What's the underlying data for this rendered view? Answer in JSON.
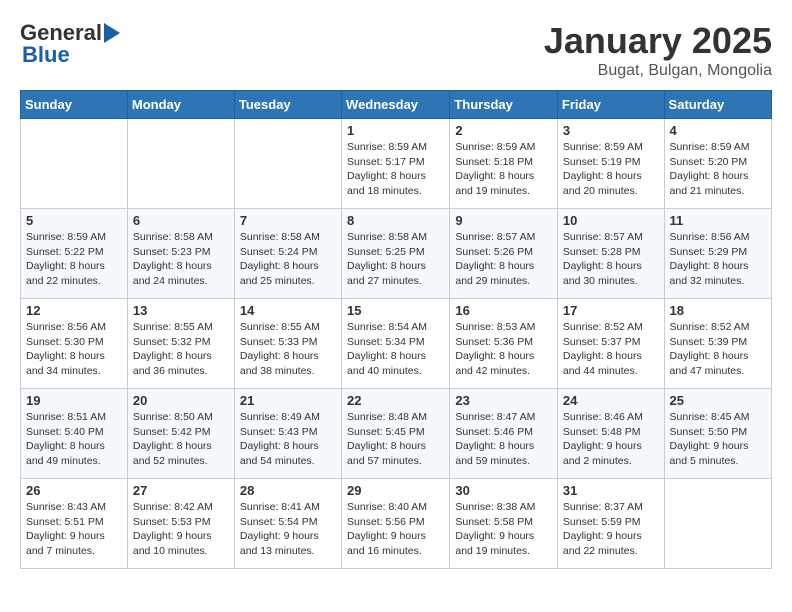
{
  "header": {
    "logo_general": "General",
    "logo_blue": "Blue",
    "month_title": "January 2025",
    "location": "Bugat, Bulgan, Mongolia"
  },
  "weekdays": [
    "Sunday",
    "Monday",
    "Tuesday",
    "Wednesday",
    "Thursday",
    "Friday",
    "Saturday"
  ],
  "weeks": [
    [
      {
        "day": "",
        "sunrise": "",
        "sunset": "",
        "daylight": ""
      },
      {
        "day": "",
        "sunrise": "",
        "sunset": "",
        "daylight": ""
      },
      {
        "day": "",
        "sunrise": "",
        "sunset": "",
        "daylight": ""
      },
      {
        "day": "1",
        "sunrise": "Sunrise: 8:59 AM",
        "sunset": "Sunset: 5:17 PM",
        "daylight": "Daylight: 8 hours and 18 minutes."
      },
      {
        "day": "2",
        "sunrise": "Sunrise: 8:59 AM",
        "sunset": "Sunset: 5:18 PM",
        "daylight": "Daylight: 8 hours and 19 minutes."
      },
      {
        "day": "3",
        "sunrise": "Sunrise: 8:59 AM",
        "sunset": "Sunset: 5:19 PM",
        "daylight": "Daylight: 8 hours and 20 minutes."
      },
      {
        "day": "4",
        "sunrise": "Sunrise: 8:59 AM",
        "sunset": "Sunset: 5:20 PM",
        "daylight": "Daylight: 8 hours and 21 minutes."
      }
    ],
    [
      {
        "day": "5",
        "sunrise": "Sunrise: 8:59 AM",
        "sunset": "Sunset: 5:22 PM",
        "daylight": "Daylight: 8 hours and 22 minutes."
      },
      {
        "day": "6",
        "sunrise": "Sunrise: 8:58 AM",
        "sunset": "Sunset: 5:23 PM",
        "daylight": "Daylight: 8 hours and 24 minutes."
      },
      {
        "day": "7",
        "sunrise": "Sunrise: 8:58 AM",
        "sunset": "Sunset: 5:24 PM",
        "daylight": "Daylight: 8 hours and 25 minutes."
      },
      {
        "day": "8",
        "sunrise": "Sunrise: 8:58 AM",
        "sunset": "Sunset: 5:25 PM",
        "daylight": "Daylight: 8 hours and 27 minutes."
      },
      {
        "day": "9",
        "sunrise": "Sunrise: 8:57 AM",
        "sunset": "Sunset: 5:26 PM",
        "daylight": "Daylight: 8 hours and 29 minutes."
      },
      {
        "day": "10",
        "sunrise": "Sunrise: 8:57 AM",
        "sunset": "Sunset: 5:28 PM",
        "daylight": "Daylight: 8 hours and 30 minutes."
      },
      {
        "day": "11",
        "sunrise": "Sunrise: 8:56 AM",
        "sunset": "Sunset: 5:29 PM",
        "daylight": "Daylight: 8 hours and 32 minutes."
      }
    ],
    [
      {
        "day": "12",
        "sunrise": "Sunrise: 8:56 AM",
        "sunset": "Sunset: 5:30 PM",
        "daylight": "Daylight: 8 hours and 34 minutes."
      },
      {
        "day": "13",
        "sunrise": "Sunrise: 8:55 AM",
        "sunset": "Sunset: 5:32 PM",
        "daylight": "Daylight: 8 hours and 36 minutes."
      },
      {
        "day": "14",
        "sunrise": "Sunrise: 8:55 AM",
        "sunset": "Sunset: 5:33 PM",
        "daylight": "Daylight: 8 hours and 38 minutes."
      },
      {
        "day": "15",
        "sunrise": "Sunrise: 8:54 AM",
        "sunset": "Sunset: 5:34 PM",
        "daylight": "Daylight: 8 hours and 40 minutes."
      },
      {
        "day": "16",
        "sunrise": "Sunrise: 8:53 AM",
        "sunset": "Sunset: 5:36 PM",
        "daylight": "Daylight: 8 hours and 42 minutes."
      },
      {
        "day": "17",
        "sunrise": "Sunrise: 8:52 AM",
        "sunset": "Sunset: 5:37 PM",
        "daylight": "Daylight: 8 hours and 44 minutes."
      },
      {
        "day": "18",
        "sunrise": "Sunrise: 8:52 AM",
        "sunset": "Sunset: 5:39 PM",
        "daylight": "Daylight: 8 hours and 47 minutes."
      }
    ],
    [
      {
        "day": "19",
        "sunrise": "Sunrise: 8:51 AM",
        "sunset": "Sunset: 5:40 PM",
        "daylight": "Daylight: 8 hours and 49 minutes."
      },
      {
        "day": "20",
        "sunrise": "Sunrise: 8:50 AM",
        "sunset": "Sunset: 5:42 PM",
        "daylight": "Daylight: 8 hours and 52 minutes."
      },
      {
        "day": "21",
        "sunrise": "Sunrise: 8:49 AM",
        "sunset": "Sunset: 5:43 PM",
        "daylight": "Daylight: 8 hours and 54 minutes."
      },
      {
        "day": "22",
        "sunrise": "Sunrise: 8:48 AM",
        "sunset": "Sunset: 5:45 PM",
        "daylight": "Daylight: 8 hours and 57 minutes."
      },
      {
        "day": "23",
        "sunrise": "Sunrise: 8:47 AM",
        "sunset": "Sunset: 5:46 PM",
        "daylight": "Daylight: 8 hours and 59 minutes."
      },
      {
        "day": "24",
        "sunrise": "Sunrise: 8:46 AM",
        "sunset": "Sunset: 5:48 PM",
        "daylight": "Daylight: 9 hours and 2 minutes."
      },
      {
        "day": "25",
        "sunrise": "Sunrise: 8:45 AM",
        "sunset": "Sunset: 5:50 PM",
        "daylight": "Daylight: 9 hours and 5 minutes."
      }
    ],
    [
      {
        "day": "26",
        "sunrise": "Sunrise: 8:43 AM",
        "sunset": "Sunset: 5:51 PM",
        "daylight": "Daylight: 9 hours and 7 minutes."
      },
      {
        "day": "27",
        "sunrise": "Sunrise: 8:42 AM",
        "sunset": "Sunset: 5:53 PM",
        "daylight": "Daylight: 9 hours and 10 minutes."
      },
      {
        "day": "28",
        "sunrise": "Sunrise: 8:41 AM",
        "sunset": "Sunset: 5:54 PM",
        "daylight": "Daylight: 9 hours and 13 minutes."
      },
      {
        "day": "29",
        "sunrise": "Sunrise: 8:40 AM",
        "sunset": "Sunset: 5:56 PM",
        "daylight": "Daylight: 9 hours and 16 minutes."
      },
      {
        "day": "30",
        "sunrise": "Sunrise: 8:38 AM",
        "sunset": "Sunset: 5:58 PM",
        "daylight": "Daylight: 9 hours and 19 minutes."
      },
      {
        "day": "31",
        "sunrise": "Sunrise: 8:37 AM",
        "sunset": "Sunset: 5:59 PM",
        "daylight": "Daylight: 9 hours and 22 minutes."
      },
      {
        "day": "",
        "sunrise": "",
        "sunset": "",
        "daylight": ""
      }
    ]
  ]
}
